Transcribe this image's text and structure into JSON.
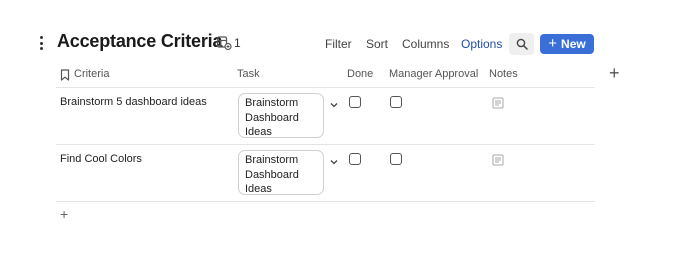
{
  "header": {
    "title": "Acceptance Criteria",
    "linked_count": "1",
    "toolbar": {
      "filter": "Filter",
      "sort": "Sort",
      "columns": "Columns",
      "options": "Options",
      "new": "New"
    },
    "accent_color": "#3b6fd8",
    "icons": [
      "more-vertical-icon",
      "linked-database-icon",
      "search-icon",
      "plus-icon"
    ]
  },
  "table": {
    "columns": [
      "Criteria",
      "Task",
      "Done",
      "Manager Approval",
      "Notes"
    ],
    "rows": [
      {
        "criteria": "Brainstorm 5 dashboard ideas",
        "task": [
          "Brainstorm",
          "Dashboard",
          "Ideas"
        ],
        "done": false,
        "manager_approval": false,
        "notes": ""
      },
      {
        "criteria": "Find Cool Colors",
        "task": [
          "Brainstorm",
          "Dashboard",
          "Ideas"
        ],
        "done": false,
        "manager_approval": false,
        "notes": ""
      }
    ]
  }
}
